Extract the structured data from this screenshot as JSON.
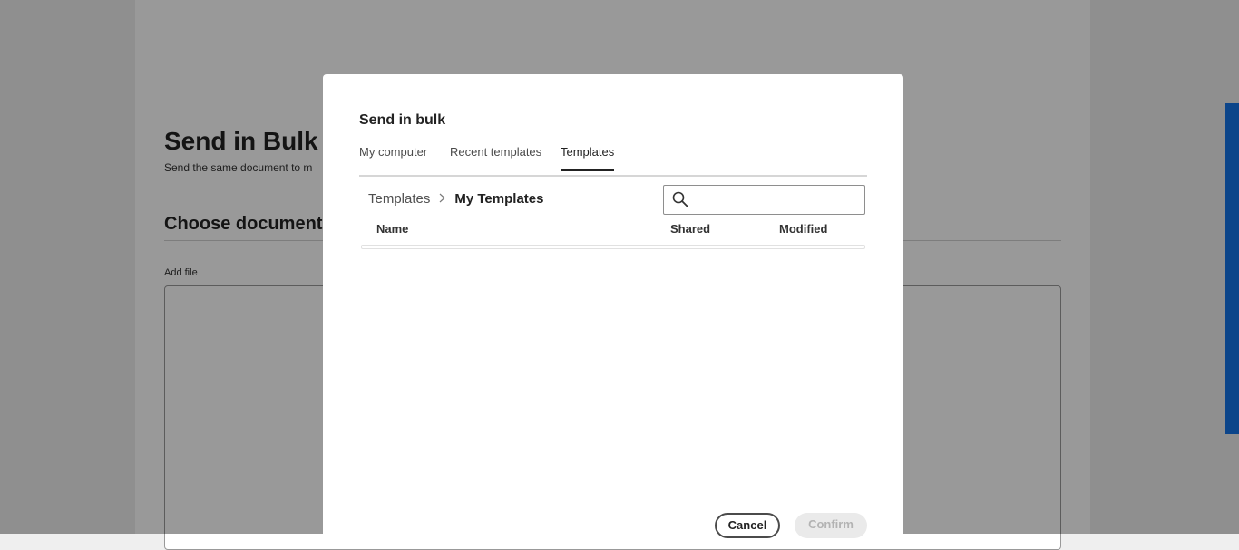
{
  "background_page": {
    "title": "Send in Bulk",
    "subtitle": "Send the same document to m",
    "section_title": "Choose documents",
    "add_file_label": "Add file"
  },
  "dialog": {
    "title": "Send in bulk",
    "tabs": [
      {
        "label": "My computer",
        "selected": false
      },
      {
        "label": "Recent templates",
        "selected": false
      },
      {
        "label": "Templates",
        "selected": true
      }
    ],
    "breadcrumb": {
      "parent": "Templates",
      "current": "My Templates"
    },
    "search": {
      "icon": "search-icon",
      "placeholder": "",
      "value": ""
    },
    "table": {
      "columns": [
        "Name",
        "Shared",
        "Modified"
      ],
      "rows": []
    },
    "buttons": {
      "cancel_label": "Cancel",
      "confirm_label": "Confirm",
      "confirm_disabled": true
    }
  },
  "colors": {
    "overlay": "#999999",
    "accent_rail": "#1473e6",
    "selected_tab_underline": "#222222",
    "disabled_button_bg": "#eaeaea"
  }
}
